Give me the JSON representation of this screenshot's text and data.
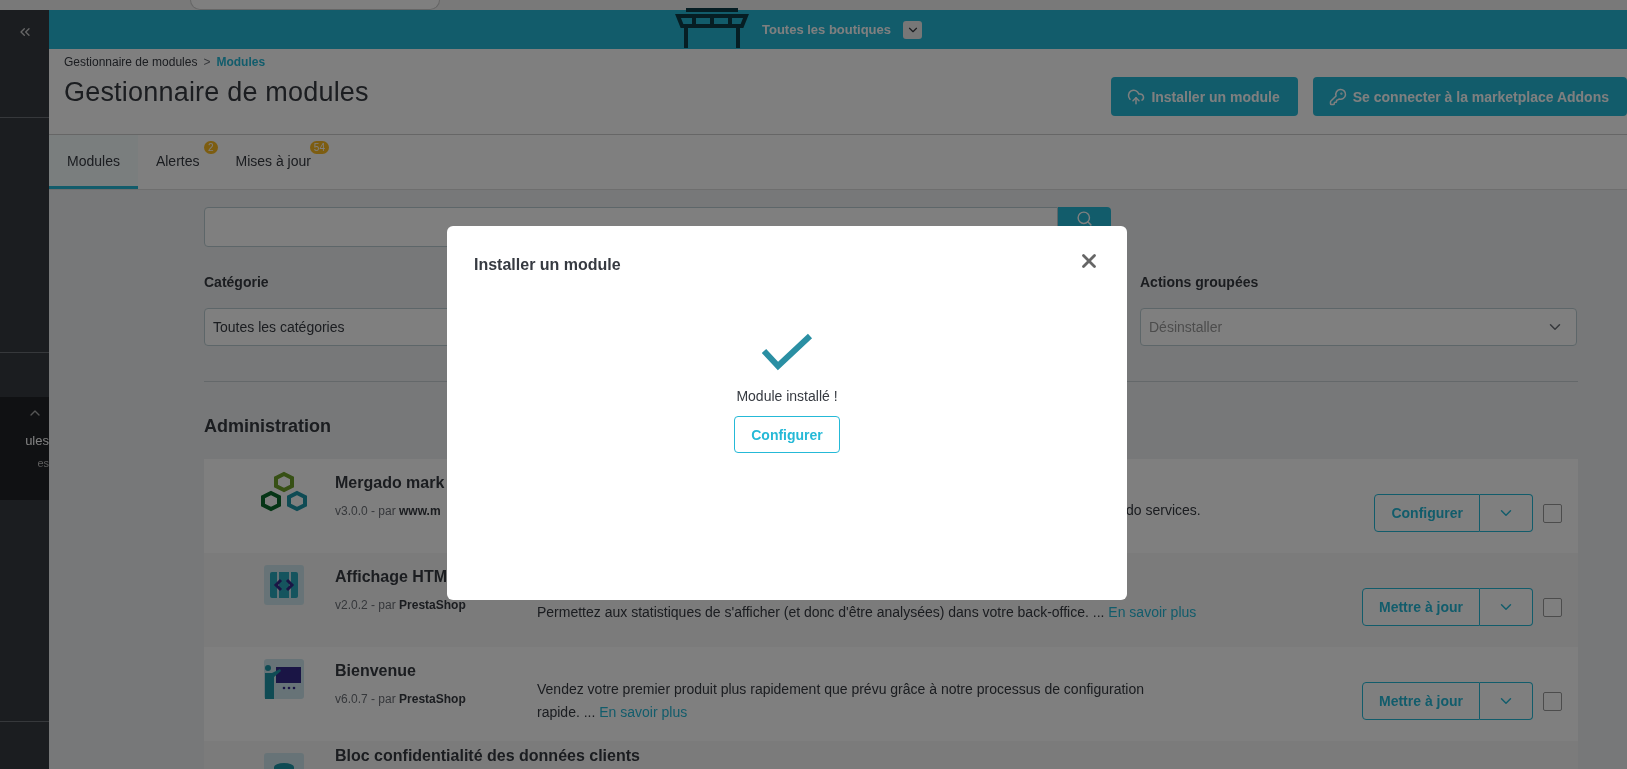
{
  "sidebar": {
    "section": {
      "expanded": true,
      "items": [
        {
          "label": "ules",
          "selected": true
        },
        {
          "label": "es",
          "selected": false
        }
      ]
    }
  },
  "header": {
    "shop_selector": "Toutes les boutiques"
  },
  "breadcrumb": {
    "separator": ">",
    "items": [
      {
        "label": "Gestionnaire de modules",
        "current": false
      },
      {
        "label": "Modules",
        "current": true
      }
    ]
  },
  "page_title": "Gestionnaire de modules",
  "toolbar_buttons": [
    {
      "label": "Installer un module",
      "kind": "upload"
    },
    {
      "label": "Se connecter à la marketplace Addons",
      "kind": "key"
    }
  ],
  "tabs": [
    {
      "label": "Modules",
      "selected": true
    },
    {
      "label": "Alertes",
      "badge": "2",
      "selected": false
    },
    {
      "label": "Mises à jour",
      "badge": "54",
      "selected": false
    }
  ],
  "filters": [
    {
      "label": "Catégorie",
      "value": "Toutes les catégories",
      "disabled": false
    },
    {
      "label": "Actions groupées",
      "value": "Désinstaller",
      "disabled": true
    }
  ],
  "section_title": "Administration",
  "modules": [
    {
      "kind": "hexagons",
      "name": "Mergado mark",
      "meta": "v3.0.0 - par **www.m**",
      "description": "do services.",
      "action": "Configurer",
      "checked": false
    },
    {
      "kind": "code",
      "name": "Affichage HTM",
      "meta": "v2.0.2 - par **PrestaShop**",
      "description": "Permettez aux statistiques de s'afficher (et donc d'être analysées) dans votre back-office. ...",
      "link": "En savoir plus",
      "action": "Mettre à jour",
      "checked": false
    },
    {
      "kind": "presenter",
      "name": "Bienvenue",
      "meta": "v6.0.7 - par **PrestaShop**",
      "description": "Vendez votre premier produit plus rapidement que prévu grâce à notre processus de configuration rapide. ...",
      "link": "En savoir plus",
      "action": "Mettre à jour",
      "checked": false
    },
    {
      "kind": "database",
      "name": "Bloc confidentialité des données clients"
    }
  ],
  "modal": {
    "title": "Installer un module",
    "message": "Module installé !",
    "button": "Configurer"
  }
}
